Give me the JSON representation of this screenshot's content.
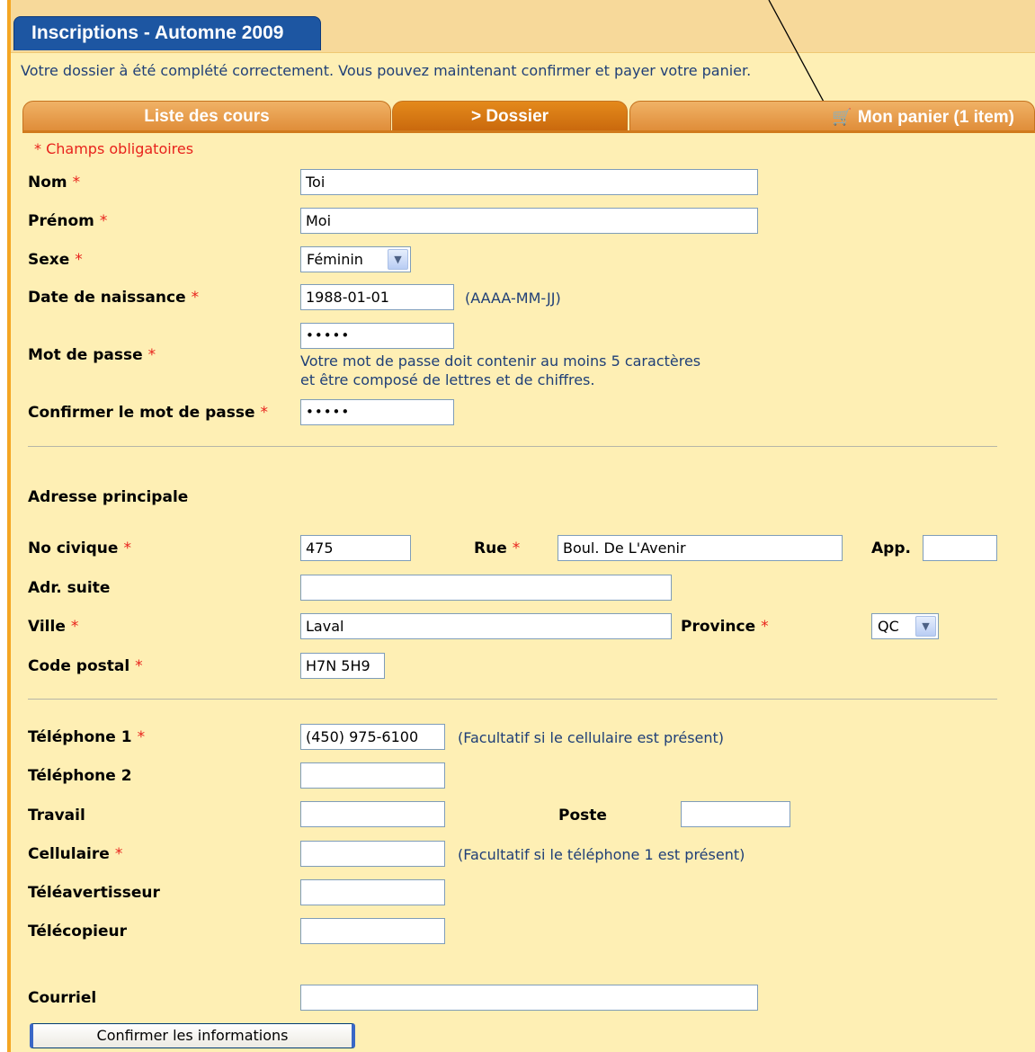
{
  "header": {
    "title": "Inscriptions - Automne 2009"
  },
  "notice": "Votre dossier à été complété correctement. Vous pouvez maintenant confirmer et payer votre panier.",
  "tabs": {
    "courses": "Liste des cours",
    "dossier": "> Dossier",
    "cart": "Mon panier (1 item)"
  },
  "required_note": "* Champs obligatoires",
  "required_mark": "*",
  "fields": {
    "nom": {
      "label": "Nom",
      "value": "Toi"
    },
    "prenom": {
      "label": "Prénom",
      "value": "Moi"
    },
    "sexe": {
      "label": "Sexe",
      "value": "Féminin"
    },
    "naissance": {
      "label": "Date de naissance",
      "value": "1988-01-01",
      "hint": "(AAAA-MM-JJ)"
    },
    "password": {
      "label": "Mot de passe",
      "value": "•••••",
      "note_line1": "Votre mot de passe doit contenir au moins 5 caractères",
      "note_line2": "et être composé de lettres et de chiffres."
    },
    "password_confirm": {
      "label": "Confirmer le mot de passe",
      "value": "•••••"
    }
  },
  "address": {
    "heading": "Adresse principale",
    "no_civique": {
      "label": "No civique",
      "value": "475"
    },
    "rue": {
      "label": "Rue",
      "value": "Boul. De L'Avenir"
    },
    "app": {
      "label": "App.",
      "value": ""
    },
    "adr_suite": {
      "label": "Adr. suite",
      "value": ""
    },
    "ville": {
      "label": "Ville",
      "value": "Laval"
    },
    "province": {
      "label": "Province",
      "value": "QC"
    },
    "code_postal": {
      "label": "Code postal",
      "value": "H7N 5H9"
    }
  },
  "phones": {
    "tel1": {
      "label": "Téléphone 1",
      "value": "(450) 975-6100",
      "hint": "(Facultatif si le cellulaire est présent)"
    },
    "tel2": {
      "label": "Téléphone 2",
      "value": ""
    },
    "travail": {
      "label": "Travail",
      "value": ""
    },
    "poste": {
      "label": "Poste",
      "value": ""
    },
    "cellulaire": {
      "label": "Cellulaire",
      "value": "",
      "hint": "(Facultatif si le téléphone 1 est présent)"
    },
    "teleavertisseur": {
      "label": "Téléavertisseur",
      "value": ""
    },
    "telecopieur": {
      "label": "Télécopieur",
      "value": ""
    }
  },
  "courriel": {
    "label": "Courriel",
    "value": ""
  },
  "confirm_label": "Confirmer les informations",
  "colors": {
    "panel": "#feefb4",
    "tab": "#df8c38",
    "title_tab": "#1d56a2",
    "required": "#e8221c",
    "note": "#1f3f77"
  },
  "icons": {
    "cart": "cart-icon"
  }
}
